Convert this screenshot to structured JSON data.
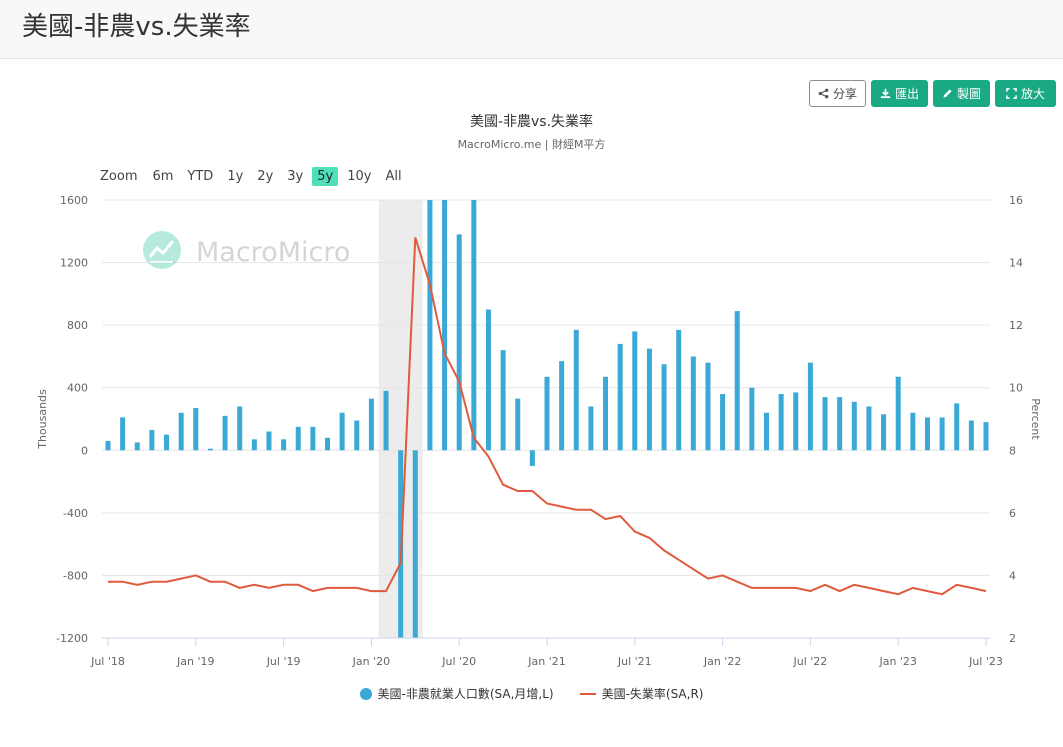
{
  "page": {
    "title": "美國-非農vs.失業率"
  },
  "toolbar": {
    "share_label": "分享",
    "export_label": "匯出",
    "draw_label": "製圖",
    "expand_label": "放大"
  },
  "zoom": {
    "label": "Zoom",
    "options": [
      "6m",
      "YTD",
      "1y",
      "2y",
      "3y",
      "5y",
      "10y",
      "All"
    ],
    "selected": "5y"
  },
  "watermark": {
    "text": "MacroMicro"
  },
  "colors": {
    "bar": "#3ba9d6",
    "line": "#e05a3d",
    "green": "#1aaa83",
    "recession": "#ececec"
  },
  "chart_data": {
    "type": "bar",
    "title": "美國-非農vs.失業率",
    "subtitle": "MacroMicro.me | 財經M平方",
    "ylabel_left": "Thousands",
    "ylabel_right": "Percent",
    "ylim_left": [
      -1200,
      1600
    ],
    "ylim_right": [
      2,
      16
    ],
    "yticks_left": [
      "1600",
      "1200",
      "800",
      "400",
      "0",
      "-400",
      "-800",
      "-1200"
    ],
    "yticks_right": [
      "16",
      "14",
      "12",
      "10",
      "8",
      "6",
      "4",
      "2"
    ],
    "xticks": [
      "Jul '18",
      "Jan '19",
      "Jul '19",
      "Jan '20",
      "Jul '20",
      "Jan '21",
      "Jul '21",
      "Jan '22",
      "Jul '22",
      "Jan '23",
      "Jul '23"
    ],
    "x": [
      "2018-07",
      "2018-08",
      "2018-09",
      "2018-10",
      "2018-11",
      "2018-12",
      "2019-01",
      "2019-02",
      "2019-03",
      "2019-04",
      "2019-05",
      "2019-06",
      "2019-07",
      "2019-08",
      "2019-09",
      "2019-10",
      "2019-11",
      "2019-12",
      "2020-01",
      "2020-02",
      "2020-03",
      "2020-04",
      "2020-05",
      "2020-06",
      "2020-07",
      "2020-08",
      "2020-09",
      "2020-10",
      "2020-11",
      "2020-12",
      "2021-01",
      "2021-02",
      "2021-03",
      "2021-04",
      "2021-05",
      "2021-06",
      "2021-07",
      "2021-08",
      "2021-09",
      "2021-10",
      "2021-11",
      "2021-12",
      "2022-01",
      "2022-02",
      "2022-03",
      "2022-04",
      "2022-05",
      "2022-06",
      "2022-07",
      "2022-08",
      "2022-09",
      "2022-10",
      "2022-11",
      "2022-12",
      "2023-01",
      "2023-02",
      "2023-03",
      "2023-04",
      "2023-05",
      "2023-06",
      "2023-07"
    ],
    "recession": [
      "2020-02",
      "2020-04"
    ],
    "series": [
      {
        "name": "美國-非農就業人口數(SA,月增,L)",
        "type": "bar",
        "axis": "left",
        "values": [
          60,
          210,
          50,
          130,
          100,
          240,
          270,
          10,
          220,
          280,
          70,
          120,
          70,
          150,
          150,
          80,
          240,
          190,
          330,
          380,
          -1370,
          -20500,
          2725,
          4781,
          1380,
          1600,
          900,
          640,
          330,
          -100,
          470,
          570,
          770,
          280,
          470,
          680,
          760,
          650,
          550,
          770,
          600,
          560,
          360,
          890,
          400,
          240,
          360,
          370,
          560,
          340,
          340,
          310,
          280,
          230,
          470,
          240,
          210,
          210,
          300,
          190,
          180
        ]
      },
      {
        "name": "美國-失業率(SA,R)",
        "type": "line",
        "axis": "right",
        "values": [
          3.8,
          3.8,
          3.7,
          3.8,
          3.8,
          3.9,
          4.0,
          3.8,
          3.8,
          3.6,
          3.7,
          3.6,
          3.7,
          3.7,
          3.5,
          3.6,
          3.6,
          3.6,
          3.5,
          3.5,
          4.4,
          14.8,
          13.3,
          11.1,
          10.2,
          8.4,
          7.8,
          6.9,
          6.7,
          6.7,
          6.3,
          6.2,
          6.1,
          6.1,
          5.8,
          5.9,
          5.4,
          5.2,
          4.8,
          4.5,
          4.2,
          3.9,
          4.0,
          3.8,
          3.6,
          3.6,
          3.6,
          3.6,
          3.5,
          3.7,
          3.5,
          3.7,
          3.6,
          3.5,
          3.4,
          3.6,
          3.5,
          3.4,
          3.7,
          3.6,
          3.5
        ]
      }
    ],
    "legend_placement": "bottom"
  }
}
